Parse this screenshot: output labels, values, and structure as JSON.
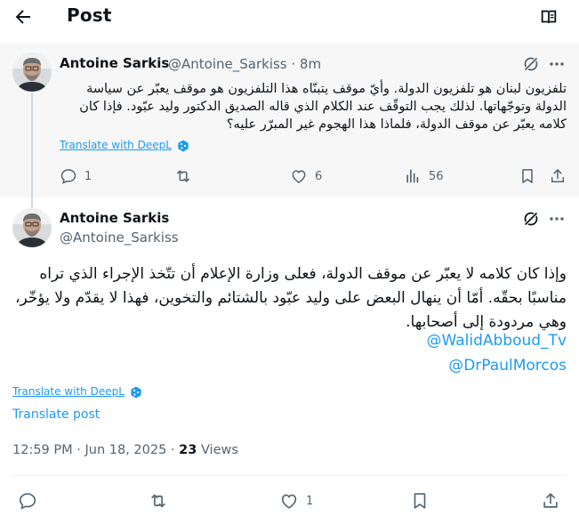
{
  "header": {
    "title": "Post"
  },
  "parent_tweet": {
    "author_name": "Antoine Sarkis",
    "author_handle": "@Antoine_Sarkiss",
    "time": "8m",
    "handle_time": "@Antoine_Sarkiss · 8m",
    "text": "تلفزيون لبنان هو تلفزيون الدولة. وأيّ موقف يتبنّاه هذا التلفزيون هو موقف يعبّر عن سياسة الدولة وتوجّهاتها. لذلك يجب التوقّف عند الكلام الذي قاله الصديق الدكتور وليد عبّود. فإذا كان كلامه يعبّر عن موقف الدولة، فلماذا هذا الهجوم غير المبرّر عليه؟",
    "translate_label": "Translate with DeepL",
    "replies": "1",
    "likes": "6",
    "views": "56"
  },
  "main_tweet": {
    "author_name": "Antoine Sarkis",
    "author_handle": "@Antoine_Sarkiss",
    "text": "وإذا كان كلامه لا يعبّر عن موقف الدولة، فعلى وزارة الإعلام أن تتّخذ الإجراء الذي تراه مناسبًا بحقّه. أمّا أن ينهال البعض على وليد عبّود بالشتائم والتخوين، فهذا لا يقدّم ولا يؤخّر، وهي مردودة إلى أصحابها.",
    "mentions": [
      "@WalidAbboud_Tv",
      "@DrPaulMorcos"
    ],
    "translate_label": "Translate with DeepL",
    "translate_post_label": "Translate post",
    "timestamp": "12:59 PM · Jun 18, 2025",
    "separator": " · ",
    "views_count": "23",
    "views_label": " Views",
    "likes": "1"
  },
  "colors": {
    "link": "#1d9bf0",
    "secondary_text": "#536471",
    "parent_bg": "#f7f7f7"
  },
  "icons": [
    "back-arrow-icon",
    "reader-mode-icon",
    "grok-icon",
    "more-icon",
    "reply-icon",
    "retweet-icon",
    "like-icon",
    "views-icon",
    "bookmark-icon",
    "share-icon",
    "deepl-icon"
  ]
}
